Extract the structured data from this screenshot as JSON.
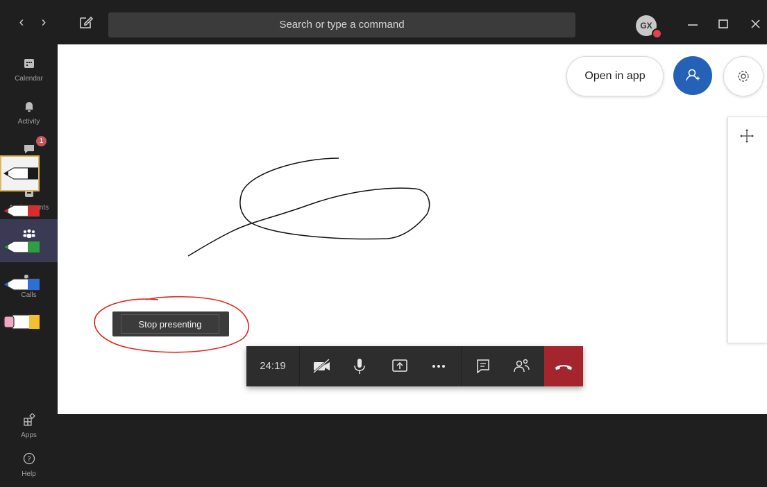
{
  "titlebar": {
    "search_placeholder": "Search or type a command",
    "avatar_initials": "GX"
  },
  "rail": {
    "items": [
      {
        "label": "Calendar",
        "icon": "calendar-icon"
      },
      {
        "label": "Activity",
        "icon": "bell-icon"
      },
      {
        "label": "Chat",
        "icon": "chat-icon",
        "badge": "1"
      },
      {
        "label": "Assignments",
        "icon": "assignments-icon"
      },
      {
        "label": "Teams",
        "icon": "teams-icon",
        "active": true
      },
      {
        "label": "Calls",
        "icon": "phone-icon"
      },
      {
        "label": "Apps",
        "icon": "apps-icon"
      },
      {
        "label": "Help",
        "icon": "help-icon"
      }
    ]
  },
  "whiteboard": {
    "open_in_app_label": "Open in app",
    "pens": [
      "black",
      "red",
      "green",
      "blue",
      "highlighter"
    ],
    "pen_colors": {
      "black": "#1a1a1a",
      "red": "#d32f2f",
      "green": "#2e9e44",
      "blue": "#2e6fd1",
      "highlighter": "#f3c12f"
    },
    "selected_pen": "black"
  },
  "presenting": {
    "stop_label": "Stop presenting"
  },
  "callbar": {
    "timer": "24:19",
    "hangup_color": "#a4262c"
  }
}
